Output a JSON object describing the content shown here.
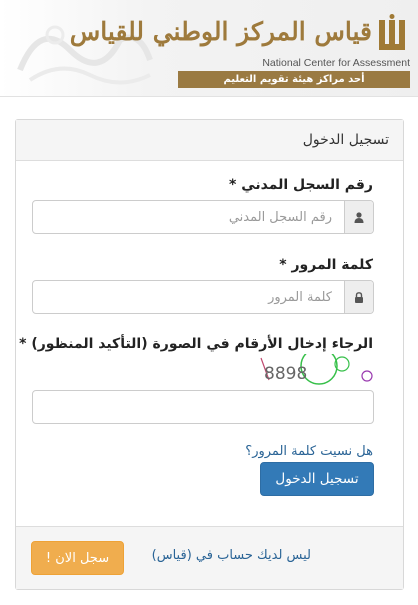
{
  "header": {
    "logo_arabic": "قياس المركز الوطني للقياس",
    "logo_english": "National Center for Assessment",
    "logo_subtitle": "أحد مراكز هيئة تقويم التعليم"
  },
  "panel": {
    "title": "تسجيل الدخول",
    "national_id": {
      "label": "رقم السجل المدني *",
      "placeholder": "رقم السجل المدني",
      "value": "",
      "icon": "user-icon"
    },
    "password": {
      "label": "كلمة المرور *",
      "placeholder": "كلمة المرور",
      "value": "",
      "icon": "lock-icon"
    },
    "captcha": {
      "label": "الرجاء إدخال الأرقام في الصورة (التأكيد المنظور) *",
      "image_text": "8898",
      "value": ""
    },
    "forgot_password": "هل نسيت كلمة المرور؟",
    "login_button": "تسجيل الدخول",
    "footer": {
      "no_account_text": "ليس لديك حساب في (قياس)",
      "register_button": "سجل الان !"
    }
  },
  "colors": {
    "primary": "#337ab7",
    "warning": "#f0ad4e",
    "link": "#2a6496",
    "brand_gold": "#9e7a3c"
  }
}
